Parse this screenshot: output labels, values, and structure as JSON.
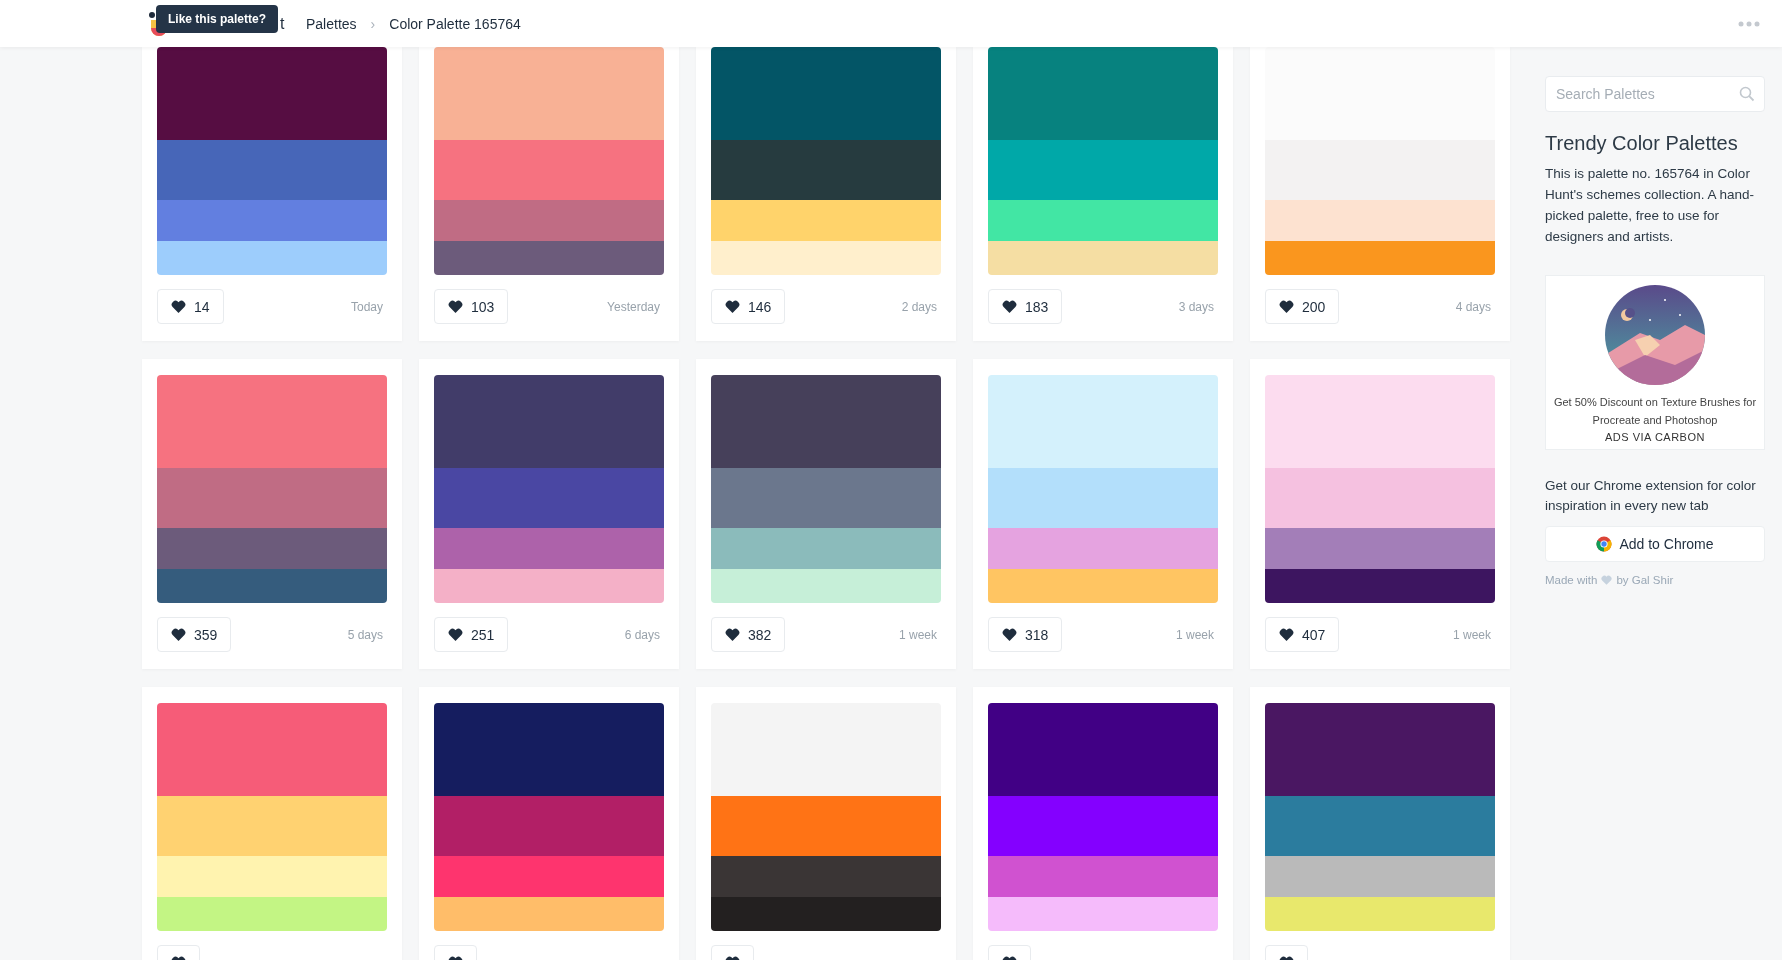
{
  "header": {
    "logo_text": "t",
    "tooltip": "Like this palette?",
    "breadcrumbs": [
      {
        "label": "Palettes"
      },
      {
        "label": "Color Palette 165764"
      }
    ],
    "separator": "›"
  },
  "palettes": [
    {
      "swatches": [
        {
          "color": "#560d42"
        },
        {
          "color": "#4766b8"
        },
        {
          "color": "#627fe0"
        },
        {
          "color": "#9dcdfc"
        }
      ],
      "likes": "14",
      "time": "Today"
    },
    {
      "swatches": [
        {
          "color": "#f8b195"
        },
        {
          "color": "#f67280"
        },
        {
          "color": "#c06c84"
        },
        {
          "color": "#6c5b7b"
        }
      ],
      "likes": "103",
      "time": "Yesterday"
    },
    {
      "swatches": [
        {
          "color": "#035566"
        },
        {
          "color": "#263b3f"
        },
        {
          "color": "#ffd36b"
        },
        {
          "color": "#ffefcc"
        }
      ],
      "likes": "146",
      "time": "2 days"
    },
    {
      "swatches": [
        {
          "color": "#07827f"
        },
        {
          "color": "#00a8a8"
        },
        {
          "color": "#42e6a4"
        },
        {
          "color": "#f5dea3"
        }
      ],
      "likes": "183",
      "time": "3 days"
    },
    {
      "swatches": [
        {
          "color": "#fbfbfb"
        },
        {
          "color": "#f3f2f2"
        },
        {
          "color": "#fde2d0"
        },
        {
          "color": "#fa961e"
        }
      ],
      "likes": "200",
      "time": "4 days"
    },
    {
      "swatches": [
        {
          "color": "#f67280"
        },
        {
          "color": "#c06c84"
        },
        {
          "color": "#6c5b7b"
        },
        {
          "color": "#355c7d"
        }
      ],
      "likes": "359",
      "time": "5 days"
    },
    {
      "swatches": [
        {
          "color": "#413c69"
        },
        {
          "color": "#4a47a3"
        },
        {
          "color": "#ad62aa"
        },
        {
          "color": "#f4b0c7"
        }
      ],
      "likes": "251",
      "time": "6 days"
    },
    {
      "swatches": [
        {
          "color": "#46405a"
        },
        {
          "color": "#6b778d"
        },
        {
          "color": "#8bbbbb"
        },
        {
          "color": "#c6efd8"
        }
      ],
      "likes": "382",
      "time": "1 week"
    },
    {
      "swatches": [
        {
          "color": "#d4f1fc"
        },
        {
          "color": "#b3dffb"
        },
        {
          "color": "#e5a3e0"
        },
        {
          "color": "#ffc562"
        }
      ],
      "likes": "318",
      "time": "1 week"
    },
    {
      "swatches": [
        {
          "color": "#fcdcef"
        },
        {
          "color": "#f5c1e0"
        },
        {
          "color": "#a37eb8"
        },
        {
          "color": "#3d1560"
        }
      ],
      "likes": "407",
      "time": "1 week"
    },
    {
      "swatches": [
        {
          "color": "#f65c78"
        },
        {
          "color": "#ffd271"
        },
        {
          "color": "#fff3af"
        },
        {
          "color": "#c3f584"
        }
      ]
    },
    {
      "swatches": [
        {
          "color": "#151d5f"
        },
        {
          "color": "#b21f66"
        },
        {
          "color": "#fe346e"
        },
        {
          "color": "#ffbd69"
        }
      ]
    },
    {
      "swatches": [
        {
          "color": "#f4f4f4"
        },
        {
          "color": "#ff7315"
        },
        {
          "color": "#3a3535"
        },
        {
          "color": "#232020"
        }
      ]
    },
    {
      "swatches": [
        {
          "color": "#410085"
        },
        {
          "color": "#8400ff"
        },
        {
          "color": "#d052d0"
        },
        {
          "color": "#f5bbfb"
        }
      ]
    },
    {
      "swatches": [
        {
          "color": "#4a1762"
        },
        {
          "color": "#2b7c9e"
        },
        {
          "color": "#bababa"
        },
        {
          "color": "#e8e86c"
        }
      ]
    }
  ],
  "sidebar": {
    "search": {
      "placeholder": "Search Palettes"
    },
    "title": "Trendy Color Palettes",
    "description": "This is palette no. 165764 in Color Hunt's schemes collection. A hand-picked palette, free to use for designers and artists.",
    "ad": {
      "kind": "picture",
      "text": "Get 50% Discount on Texture Brushes for Procreate and Photoshop",
      "via": "ADS VIA CARBON"
    },
    "chrome_text": "Get our Chrome extension for color inspiration in every new tab",
    "chrome_button": "Add to Chrome",
    "credit_before": "Made with",
    "credit_after": "by Gal Shir"
  }
}
